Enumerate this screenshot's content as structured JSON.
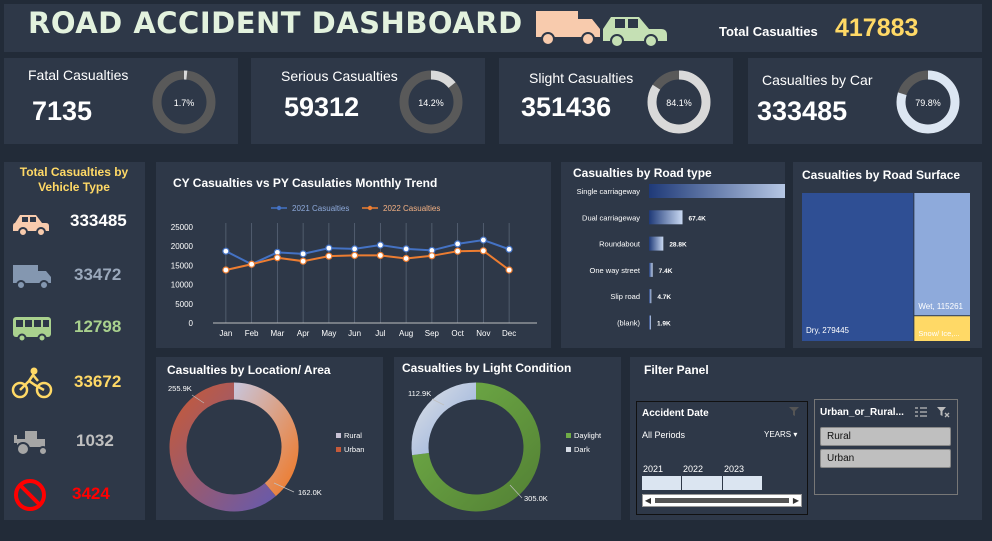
{
  "header": {
    "title": "ROAD ACCIDENT DASHBOARD",
    "total_label": "Total Casualties",
    "total_value": "417883"
  },
  "kpis": [
    {
      "label": "Fatal Casualties",
      "value": "7135",
      "percent_label": "1.7%",
      "percent": 1.7
    },
    {
      "label": "Serious Casualties",
      "value": "59312",
      "percent_label": "14.2%",
      "percent": 14.2
    },
    {
      "label": "Slight Casualties",
      "value": "351436",
      "percent_label": "84.1%",
      "percent": 84.1
    },
    {
      "label": "Casualties by Car",
      "value": "333485",
      "percent_label": "79.8%",
      "percent": 79.8
    }
  ],
  "vehicle": {
    "title": "Total Casualties by Vehicle Type",
    "items": [
      {
        "icon": "car-icon",
        "value": "333485",
        "color": "#ffffff"
      },
      {
        "icon": "truck-icon",
        "value": "33472",
        "color": "#9aa8bb"
      },
      {
        "icon": "bus-icon",
        "value": "12798",
        "color": "#a9d18e"
      },
      {
        "icon": "bicycle-icon",
        "value": "33672",
        "color": "#ffd966"
      },
      {
        "icon": "tractor-icon",
        "value": "1032",
        "color": "#bfbfbf"
      },
      {
        "icon": "no-entry-icon",
        "value": "3424",
        "color": "#ff0000"
      }
    ]
  },
  "colors": {
    "accent_blue": "#4472c4",
    "accent_orange": "#ed7d31",
    "yellow": "#ffd966",
    "panel": "#2e3848",
    "background": "#222b38"
  },
  "chart_data": [
    {
      "type": "line",
      "title": "CY Casualties vs PY Casulaties Monthly Trend",
      "categories": [
        "Jan",
        "Feb",
        "Mar",
        "Apr",
        "May",
        "Jun",
        "Jul",
        "Aug",
        "Sep",
        "Oct",
        "Nov",
        "Dec"
      ],
      "series": [
        {
          "name": "2021 Casualties",
          "values": [
            18700,
            15300,
            18400,
            18000,
            19500,
            19300,
            20300,
            19300,
            18900,
            20600,
            21600,
            19200
          ],
          "color": "#4472c4"
        },
        {
          "name": "2022 Casualties",
          "values": [
            13800,
            15300,
            17000,
            16100,
            17400,
            17600,
            17600,
            16800,
            17500,
            18700,
            18800,
            13800
          ],
          "color": "#ed7d31"
        }
      ],
      "yticks": [
        "0",
        "5000",
        "10000",
        "15000",
        "20000",
        "25000"
      ],
      "ylim": [
        0,
        25000
      ],
      "legend": "top"
    },
    {
      "type": "bar",
      "title": "Casualties by Road type",
      "categories": [
        "Single carriageway",
        "Dual carriageway",
        "Roundabout",
        "One way street",
        "Slip road",
        "(blank)"
      ],
      "values": [
        309700,
        67400,
        28800,
        7400,
        4700,
        1900
      ],
      "labels": [
        "309.7K",
        "67.4K",
        "28.8K",
        "7.4K",
        "4.7K",
        "1.9K"
      ]
    },
    {
      "type": "heatmap",
      "title": "Casualties by Road Surface",
      "items": [
        {
          "label": "Dry, 279445",
          "value": 279445,
          "color": "#2f4f94"
        },
        {
          "label": "Wet, 115261",
          "value": 115261,
          "color": "#8eaadb"
        },
        {
          "label": "Snow/ Ice,...",
          "value": 23177,
          "color": "#ffd966"
        }
      ]
    },
    {
      "type": "pie",
      "title": "Casualties by Location/ Area",
      "slices": [
        {
          "name": "Rural",
          "value": 162000,
          "label": "162.0K"
        },
        {
          "name": "Urban",
          "value": 255900,
          "label": "255.9K"
        }
      ],
      "legend": "right"
    },
    {
      "type": "pie",
      "title": "Casualties by Light Condition",
      "slices": [
        {
          "name": "Daylight",
          "value": 305000,
          "label": "305.0K"
        },
        {
          "name": "Dark",
          "value": 112900,
          "label": "112.9K"
        }
      ],
      "legend": "right"
    }
  ],
  "filter": {
    "title": "Filter Panel",
    "date_title": "Accident Date",
    "all_periods": "All Periods",
    "years_label": "YEARS",
    "years": [
      "2021",
      "2022",
      "2023"
    ],
    "urban_title": "Urban_or_Rural...",
    "urban_options": [
      "Rural",
      "Urban"
    ]
  }
}
